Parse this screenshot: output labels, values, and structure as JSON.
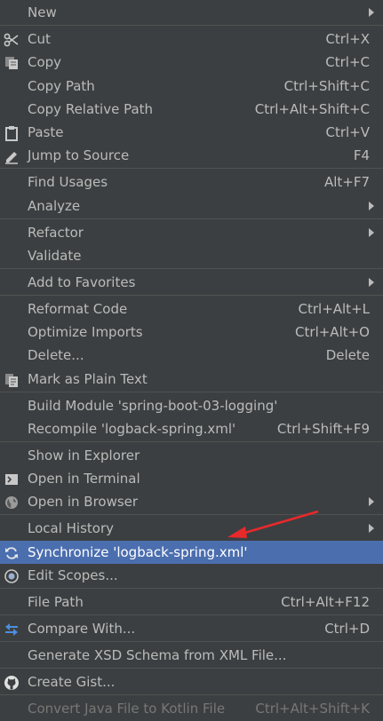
{
  "menu": {
    "new": "New",
    "cut": "Cut",
    "cut_sc": "Ctrl+X",
    "copy": "Copy",
    "copy_sc": "Ctrl+C",
    "copy_path": "Copy Path",
    "copy_path_sc": "Ctrl+Shift+C",
    "copy_rel": "Copy Relative Path",
    "copy_rel_sc": "Ctrl+Alt+Shift+C",
    "paste": "Paste",
    "paste_sc": "Ctrl+V",
    "jump": "Jump to Source",
    "jump_sc": "F4",
    "find": "Find Usages",
    "find_sc": "Alt+F7",
    "analyze": "Analyze",
    "refactor": "Refactor",
    "validate": "Validate",
    "favorites": "Add to Favorites",
    "reformat": "Reformat Code",
    "reformat_sc": "Ctrl+Alt+L",
    "optimize": "Optimize Imports",
    "optimize_sc": "Ctrl+Alt+O",
    "delete": "Delete...",
    "delete_sc": "Delete",
    "plain": "Mark as Plain Text",
    "build": "Build Module 'spring-boot-03-logging'",
    "recompile": "Recompile 'logback-spring.xml'",
    "recompile_sc": "Ctrl+Shift+F9",
    "explorer": "Show in Explorer",
    "terminal": "Open in Terminal",
    "browser": "Open in Browser",
    "history": "Local History",
    "sync": "Synchronize 'logback-spring.xml'",
    "scopes": "Edit Scopes...",
    "filepath": "File Path",
    "filepath_sc": "Ctrl+Alt+F12",
    "compare": "Compare With...",
    "compare_sc": "Ctrl+D",
    "xsd": "Generate XSD Schema from XML File...",
    "gist": "Create Gist...",
    "kotlin": "Convert Java File to Kotlin File",
    "kotlin_sc": "Ctrl+Alt+Shift+K"
  },
  "colors": {
    "background": "#3c3f41",
    "selection": "#4b6eaf",
    "annotation_arrow": "#e8292c"
  }
}
